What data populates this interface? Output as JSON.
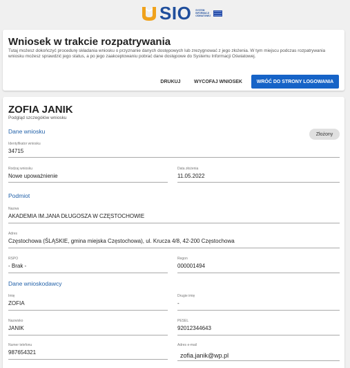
{
  "logo": {
    "text": "SIO",
    "subtext_lines": [
      "SYSTEM",
      "INFORMACJI",
      "OŚWIATOWEJ"
    ]
  },
  "header_card": {
    "title": "Wniosek w trakcie rozpatrywania",
    "description": "Tutaj możesz dokończyć procedurę składania wniosku o przyznanie danych dostępowych lub zrezygnować z jego złożenia. W tym miejscu podczas rozpatrywania wniosku możesz sprawdzić jego status, a po jego zaakceptowaniu pobrać dane dostępowe do Systemu Informacji Oświatowej.",
    "buttons": {
      "print": "DRUKUJ",
      "withdraw": "WYCOFAJ WNIOSEK",
      "back": "WRÓĆ DO STRONY LOGOWANIA"
    }
  },
  "details": {
    "name": "ZOFIA JANIK",
    "subtitle": "Podgląd szczegółów wniosku",
    "status_badge": "Złożony",
    "sections": {
      "application": "Dane wniosku",
      "entity": "Podmiot",
      "applicant": "Dane wnioskodawcy"
    },
    "fields": {
      "id": {
        "label": "Identyfikator wniosku",
        "value": "34715"
      },
      "type": {
        "label": "Rodzaj wniosku",
        "value": "Nowe upoważnienie"
      },
      "date": {
        "label": "Data złożenia",
        "value": "11.05.2022"
      },
      "entity_name": {
        "label": "Nazwa",
        "value": "AKADEMIA IM.JANA DŁUGOSZA W CZĘSTOCHOWIE"
      },
      "address": {
        "label": "Adres",
        "value": "Częstochowa (ŚLĄSKIE, gmina miejska Częstochowa), ul. Krucza 4/8, 42-200 Częstochowa"
      },
      "rspo": {
        "label": "RSPO",
        "value": "- Brak -"
      },
      "regon": {
        "label": "Regon",
        "value": "000001494"
      },
      "first_name": {
        "label": "Imię",
        "value": "ZOFIA"
      },
      "second_name": {
        "label": "Drugie imię",
        "value": "-"
      },
      "surname": {
        "label": "Nazwisko",
        "value": "JANIK"
      },
      "pesel": {
        "label": "PESEL",
        "value": "92012344643"
      },
      "phone": {
        "label": "Numer telefonu",
        "value": "987654321"
      },
      "email": {
        "label": "Adres e-mail",
        "value": "zofia.janik@wp.pl"
      }
    }
  },
  "colors": {
    "primary": "#1663c7",
    "section": "#1f5fa8",
    "logo_orange": "#f0a21c",
    "logo_blue": "#1f4e9c"
  }
}
